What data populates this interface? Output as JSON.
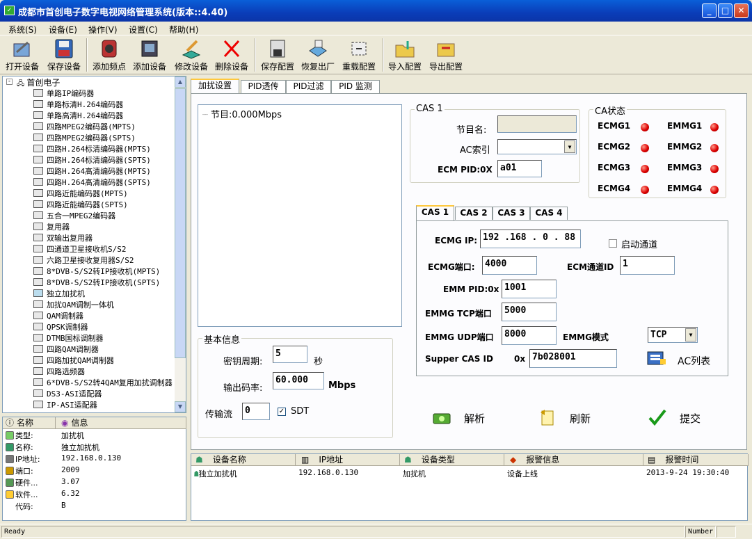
{
  "window": {
    "title": "成都市首创电子数字电视网络管理系统(版本::4.40)"
  },
  "menu": [
    "系统(S)",
    "设备(E)",
    "操作(V)",
    "设置(C)",
    "帮助(H)"
  ],
  "toolbar": [
    "打开设备",
    "保存设备",
    "添加频点",
    "添加设备",
    "修改设备",
    "删除设备",
    "保存配置",
    "恢复出厂",
    "重载配置",
    "导入配置",
    "导出配置"
  ],
  "tree": {
    "root": "首创电子",
    "items": [
      "单路IP编码器",
      "单路标清H.264编码器",
      "单路高清H.264编码器",
      "四路MPEG2编码器(MPTS)",
      "四路MPEG2编码器(SPTS)",
      "四路H.264标清编码器(MPTS)",
      "四路H.264标清编码器(SPTS)",
      "四路H.264高清编码器(MPTS)",
      "四路H.264高清编码器(SPTS)",
      "四路近能编码器(MPTS)",
      "四路近能编码器(SPTS)",
      "五合一MPEG2编码器",
      "复用器",
      "双输出复用器",
      "四通道卫星接收机S/S2",
      "六路卫星接收复用器S/S2",
      "8*DVB-S/S2转IP接收机(MPTS)",
      "8*DVB-S/S2转IP接收机(SPTS)",
      "独立加扰机",
      "加扰QAM调制一体机",
      "QAM调制器",
      "QPSK调制器",
      "DTMB国标调制器",
      "四路QAM调制器",
      "四路加扰QAM调制器",
      "四路选频器",
      "6*DVB-S/S2转4QAM复用加扰调制器",
      "DS3-ASI适配器",
      "IP-ASI适配器"
    ]
  },
  "props": {
    "headers": [
      "名称",
      "信息"
    ],
    "rows": [
      {
        "k": "类型:",
        "v": "加扰机"
      },
      {
        "k": "名称:",
        "v": "独立加扰机"
      },
      {
        "k": "IP地址:",
        "v": "192.168.0.130"
      },
      {
        "k": "端口:",
        "v": "2009"
      },
      {
        "k": "硬件...",
        "v": "3.07"
      },
      {
        "k": "软件...",
        "v": "6.32"
      },
      {
        "k": "代码:",
        "v": "B"
      }
    ]
  },
  "tabs": [
    "加扰设置",
    "PID透传",
    "PID过滤",
    "PID 监测"
  ],
  "program": {
    "text": "节目:0.000Mbps"
  },
  "basic": {
    "title": "基本信息",
    "key_period_label": "密钥周期:",
    "key_period": "5",
    "key_period_unit": "秒",
    "bitrate_label": "输出码率:",
    "bitrate": "60.000",
    "bitrate_unit": "Mbps",
    "ts_label": "传输流",
    "ts": "0",
    "sdt_label": "SDT"
  },
  "cas1": {
    "title": "CAS 1",
    "prog_name_label": "节目名:",
    "prog_name": "",
    "ac_index_label": "AC索引",
    "ac_index": "",
    "ecm_pid_label": "ECM PID:0X",
    "ecm_pid": "a01"
  },
  "ca_status": {
    "title": "CA状态",
    "items": [
      "ECMG1",
      "EMMG1",
      "ECMG2",
      "EMMG2",
      "ECMG3",
      "EMMG3",
      "ECMG4",
      "EMMG4"
    ]
  },
  "cas_tabs": [
    "CAS 1",
    "CAS 2",
    "CAS 3",
    "CAS 4"
  ],
  "cas": {
    "ecmg_ip_label": "ECMG IP:",
    "ecmg_ip": "192 .168 . 0  . 88",
    "enable_label": "启动通道",
    "ecmg_port_label": "ECMG端口:",
    "ecmg_port": "4000",
    "ecm_channel_label": "ECM通道ID",
    "ecm_channel": "1",
    "emm_pid_label": "EMM PID:0x",
    "emm_pid": "1001",
    "emmg_tcp_label": "EMMG TCP端口",
    "emmg_tcp": "5000",
    "emmg_udp_label": "EMMG UDP端口",
    "emmg_udp": "8000",
    "emmg_mode_label": "EMMG模式",
    "emmg_mode": "TCP",
    "supper_cas_label": "Supper CAS ID",
    "supper_cas_prefix": "0x",
    "supper_cas": "7b028001",
    "ac_list_label": "AC列表"
  },
  "actions": [
    "解析",
    "刷新",
    "提交"
  ],
  "alarms": {
    "headers": [
      "设备名称",
      "IP地址",
      "设备类型",
      "报警信息",
      "报警时间"
    ],
    "row": [
      "独立加扰机",
      "192.168.0.130",
      "加扰机",
      "设备上线",
      "2013-9-24 19:30:40"
    ]
  },
  "status": {
    "left": "Ready",
    "right": "Number"
  }
}
